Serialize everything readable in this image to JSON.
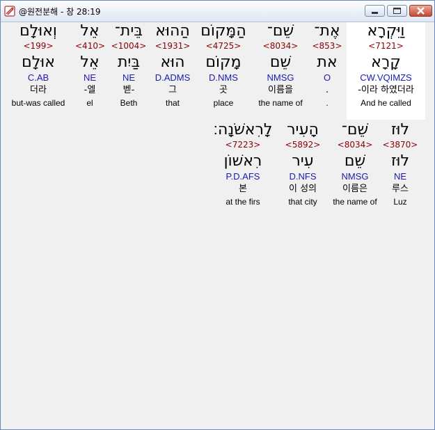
{
  "window": {
    "title": "@원전분해 - 창 28:19"
  },
  "icons": {
    "app": "scroll-app-icon",
    "minimize": "minimize-icon",
    "maximize": "maximize-icon",
    "close": "close-icon"
  },
  "row1": [
    {
      "heb": "וַיִּקְרָא",
      "num": "<7121>",
      "lemma": "קָרָא",
      "morph": "CW.VQIMZS",
      "kor": "-이라 하였더라",
      "eng": "And he called",
      "highlighted": true
    },
    {
      "heb": "אֶת־",
      "num": "<853>",
      "lemma": "את",
      "morph": "O",
      "kor": ".",
      "eng": "."
    },
    {
      "heb": "שֵׁם־",
      "num": "<8034>",
      "lemma": "שֵׁם",
      "morph": "NMSG",
      "kor": "이름을",
      "eng": "the name of"
    },
    {
      "heb": "הַמָּקוֹם",
      "num": "<4725>",
      "lemma": "מָקוֹם",
      "morph": "D.NMS",
      "kor": "곳",
      "eng": "place"
    },
    {
      "heb": "הַהוּא",
      "num": "<1931>",
      "lemma": "הוּא",
      "morph": "D.ADMS",
      "kor": "그",
      "eng": "that"
    },
    {
      "heb": "בֵּית־",
      "num": "<1004>",
      "lemma": "בַּיִת",
      "morph": "NE",
      "kor": "벧-",
      "eng": "Beth"
    },
    {
      "heb": "אֵל",
      "num": "<410>",
      "lemma": "אֵל",
      "morph": "NE",
      "kor": "-엘",
      "eng": "el"
    },
    {
      "heb": "וְאוּלָם",
      "num": "<199>",
      "lemma": "אוּלָם",
      "morph": "C.AB",
      "kor": "더라",
      "eng": "but-was called"
    }
  ],
  "row2": [
    {
      "heb": "לוּז",
      "num": "<3870>",
      "lemma": "לוּז",
      "morph": "NE",
      "kor": "루스",
      "eng": "Luz"
    },
    {
      "heb": "שֵׁם־",
      "num": "<8034>",
      "lemma": "שֵׁם",
      "morph": "NMSG",
      "kor": "이름은",
      "eng": "the name of"
    },
    {
      "heb": "הָעִיר",
      "num": "<5892>",
      "lemma": "עִיר",
      "morph": "D.NFS",
      "kor": "이 성의",
      "eng": "that city"
    },
    {
      "heb": "לָרִאשֹׁנָה׃",
      "num": "<7223>",
      "lemma": "רִאשׁוֹן",
      "morph": "P.D.AFS",
      "kor": "본",
      "eng": "at the firs"
    }
  ]
}
